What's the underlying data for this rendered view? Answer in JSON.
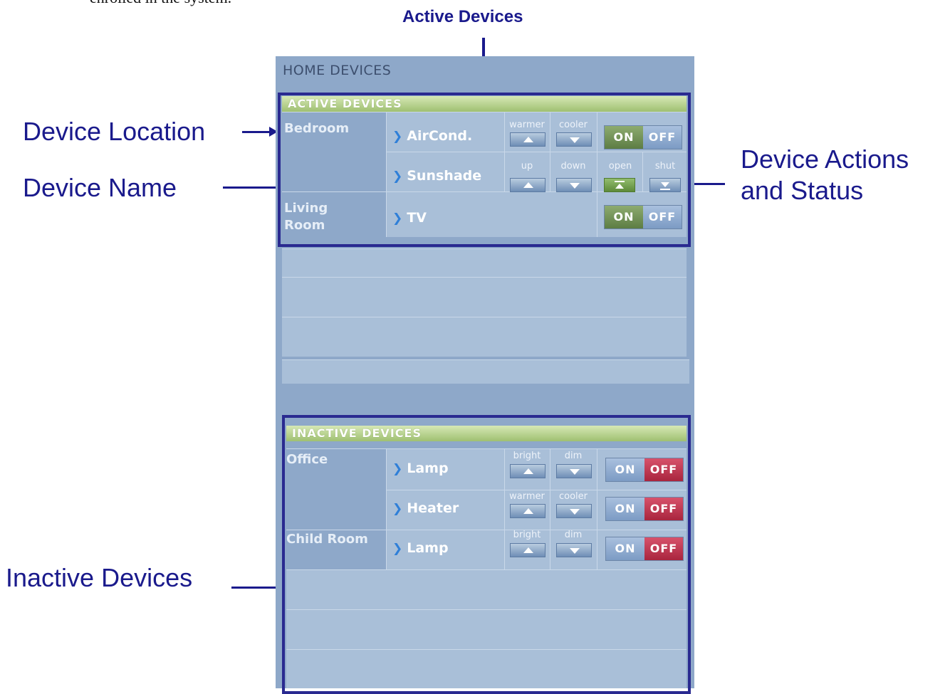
{
  "page": {
    "top_text": "enrolled in the system."
  },
  "callouts": {
    "active_devices": "Active Devices",
    "device_location": "Device Location",
    "device_name": "Device Name",
    "device_actions_line1": "Device Actions",
    "device_actions_line2": "and Status",
    "inactive_devices": "Inactive Devices"
  },
  "panel": {
    "title": "HOME DEVICES",
    "active": {
      "header": "ACTIVE DEVICES",
      "rows": [
        {
          "location": "Bedroom",
          "device": "AirCond.",
          "action1": "warmer",
          "action2": "cooler",
          "on": "ON",
          "off": "OFF",
          "state": "on"
        },
        {
          "location": "",
          "device": "Sunshade",
          "action1": "up",
          "action2": "down",
          "action3": "open",
          "action4": "shut",
          "state": "open"
        },
        {
          "location": "Living Room",
          "device": "TV",
          "on": "ON",
          "off": "OFF",
          "state": "on"
        }
      ]
    },
    "inactive": {
      "header": "INACTIVE DEVICES",
      "rows": [
        {
          "location": "Office",
          "device": "Lamp",
          "action1": "bright",
          "action2": "dim",
          "on": "ON",
          "off": "OFF",
          "state": "off"
        },
        {
          "location": "",
          "device": "Heater",
          "action1": "warmer",
          "action2": "cooler",
          "on": "ON",
          "off": "OFF",
          "state": "off"
        },
        {
          "location": "Child Room",
          "device": "Lamp",
          "action1": "bright",
          "action2": "dim",
          "on": "ON",
          "off": "OFF",
          "state": "off"
        }
      ]
    }
  },
  "colors": {
    "callout_text": "#1a1a8c",
    "frame": "#2a2a90",
    "on_active": "#5d7d44",
    "off_inactive": "#a9253e"
  },
  "icons": {
    "chevron": "chevron-right-icon",
    "up": "up-arrow-icon",
    "down": "down-arrow-icon"
  }
}
